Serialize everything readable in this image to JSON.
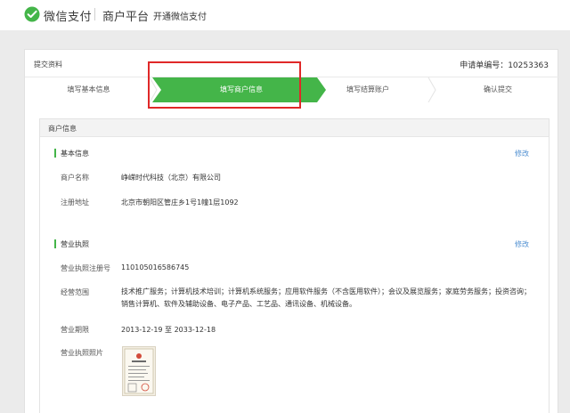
{
  "header": {
    "brand": "微信支付",
    "platform": "商户平台",
    "subtitle": "开通微信支付"
  },
  "card": {
    "title": "提交资料",
    "application_no": "申请单编号：10253363"
  },
  "steps": [
    {
      "label": "填写基本信息",
      "state": "done"
    },
    {
      "label": "填写商户信息",
      "state": "active"
    },
    {
      "label": "填写结算账户",
      "state": "todo"
    },
    {
      "label": "确认提交",
      "state": "todo"
    }
  ],
  "colors": {
    "accent_green": "#44b549",
    "link_blue": "#4f8fd1",
    "highlight_red": "#e02828"
  },
  "merchant": {
    "section_title": "商户信息",
    "basic": {
      "title": "基本信息",
      "edit_label": "修改",
      "name_label": "商户名称",
      "name_value": "峥嵘时代科技（北京）有限公司",
      "address_label": "注册地址",
      "address_value": "北京市朝阳区管庄乡1号1幢1层1092"
    },
    "license": {
      "title": "营业执照",
      "edit_label": "修改",
      "reg_no_label": "营业执照注册号",
      "reg_no_value": "110105016586745",
      "scope_label": "经营范围",
      "scope_value": "技术推广服务；计算机技术培训；计算机系统服务；应用软件服务（不含医用软件）；会议及展览服务；家庭劳务服务；投资咨询；销售计算机、软件及辅助设备、电子产品、工艺品、通讯设备、机械设备。",
      "period_label": "营业期限",
      "period_value": "2013-12-19 至 2033-12-18",
      "photo_label": "营业执照照片",
      "photo_icon": "license-document-icon"
    }
  }
}
